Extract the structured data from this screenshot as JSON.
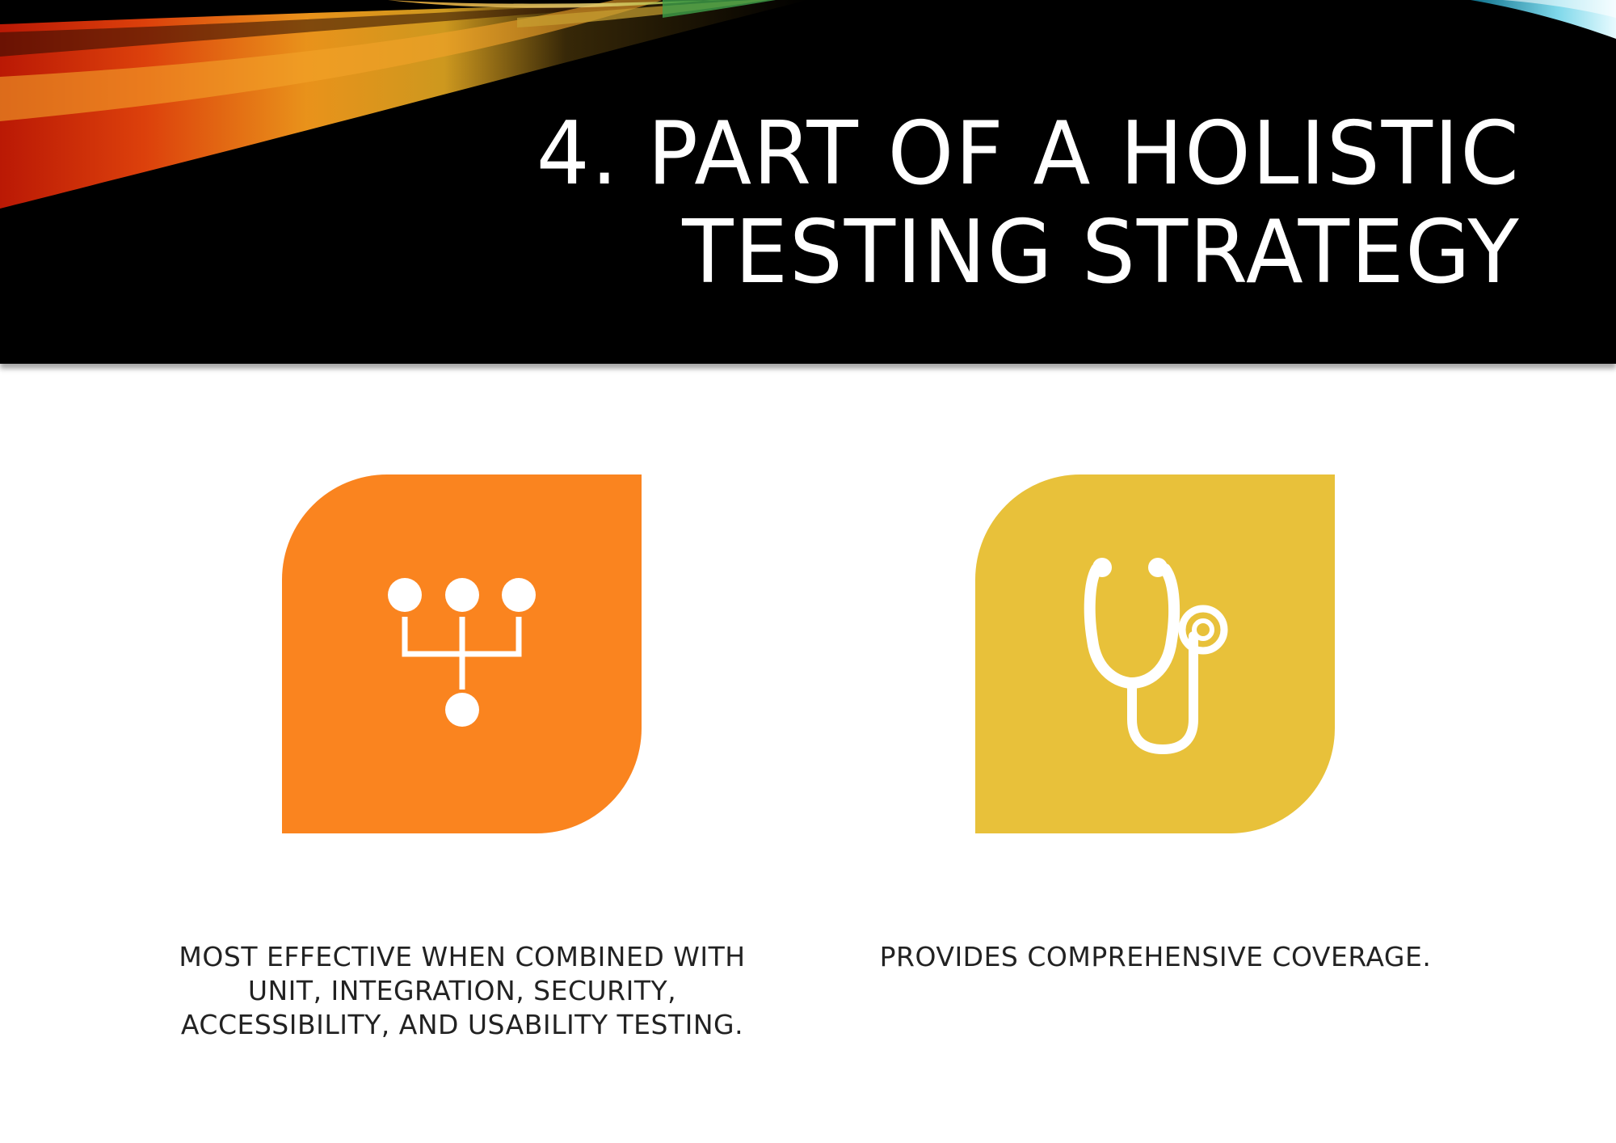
{
  "slide": {
    "title_line1": "4. PART OF A HOLISTIC",
    "title_line2": "TESTING STRATEGY"
  },
  "cards": [
    {
      "icon": "hierarchy-icon",
      "color": "#FA841F",
      "caption_line1": "MOST EFFECTIVE WHEN COMBINED WITH",
      "caption_line2": "UNIT, INTEGRATION, SECURITY,",
      "caption_line3": "ACCESSIBILITY, AND USABILITY TESTING."
    },
    {
      "icon": "stethoscope-icon",
      "color": "#E8C13A",
      "caption_line1": "PROVIDES COMPREHENSIVE COVERAGE."
    }
  ],
  "colors": {
    "title_band": "#000000",
    "title_text": "#FFFFFF",
    "caption_text": "#222222"
  }
}
